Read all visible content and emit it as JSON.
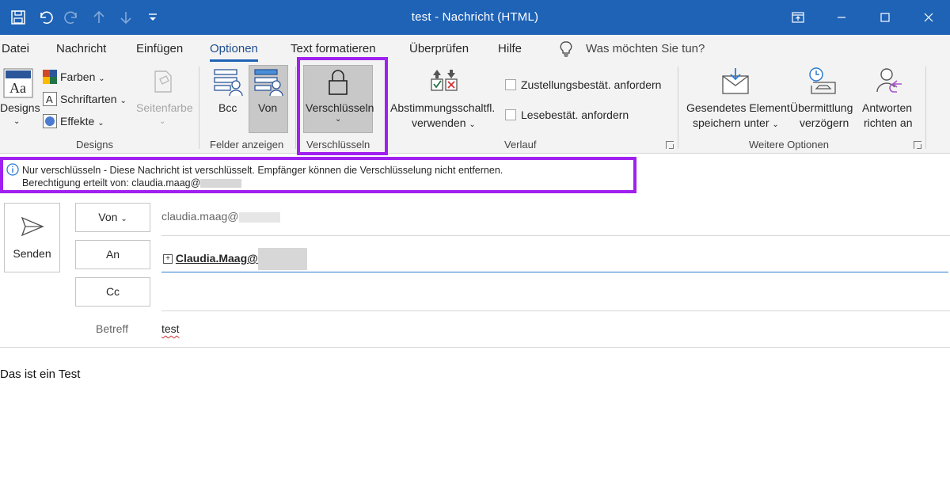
{
  "window": {
    "title": "test  -  Nachricht (HTML)",
    "quick_access": [
      "save-icon",
      "undo-icon",
      "redo-icon",
      "up-icon",
      "down-icon",
      "customize-icon"
    ],
    "controls": [
      "ribbon-display-icon",
      "minimize-icon",
      "maximize-icon",
      "close-icon"
    ]
  },
  "tabs": [
    "Datei",
    "Nachricht",
    "Einfügen",
    "Optionen",
    "Text formatieren",
    "Überprüfen",
    "Hilfe"
  ],
  "active_tab": "Optionen",
  "tell_me": "Was möchten Sie tun?",
  "ribbon": {
    "designs": {
      "group_label": "Designs",
      "designs_label": "Designs",
      "farben": "Farben",
      "schriftarten": "Schriftarten",
      "effekte": "Effekte",
      "seitenfarbe": "Seitenfarbe"
    },
    "felder": {
      "group_label": "Felder anzeigen",
      "bcc": "Bcc",
      "von": "Von"
    },
    "verschluesseln": {
      "group_label": "Verschlüsseln",
      "button": "Verschlüsseln"
    },
    "verlauf": {
      "group_label": "Verlauf",
      "voting_line1": "Abstimmungsschaltfl.",
      "voting_line2": "verwenden",
      "zustellung": "Zustellungsbestät. anfordern",
      "lese": "Lesebestät. anfordern"
    },
    "weitere": {
      "group_label": "Weitere Optionen",
      "save_line1": "Gesendetes Element",
      "save_line2": "speichern unter",
      "delay_line1": "Übermittlung",
      "delay_line2": "verzögern",
      "reply_line1": "Antworten",
      "reply_line2": "richten an"
    }
  },
  "infobar": {
    "line1": "Nur verschlüsseln - Diese Nachricht ist verschlüsselt. Empfänger können die Verschlüsselung nicht entfernen.",
    "line2": "Berechtigung erteilt von: claudia.maag@"
  },
  "compose": {
    "send": "Senden",
    "von_button": "Von",
    "von_value": "claudia.maag@",
    "an_button": "An",
    "an_value": "Claudia.Maag@",
    "cc_button": "Cc",
    "betreff_label": "Betreff",
    "betreff_value": "test",
    "body": "Das ist ein Test"
  },
  "colors": {
    "titlebar": "#1f63b6",
    "highlight": "#a020f0",
    "ribbon_bg": "#f3f3f3"
  }
}
